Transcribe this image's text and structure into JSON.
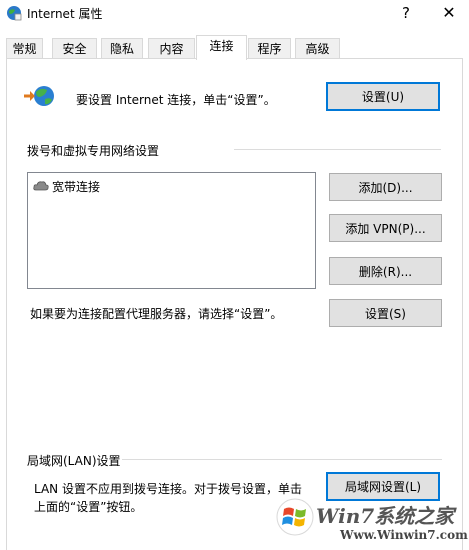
{
  "window": {
    "title": "Internet 属性",
    "help": "?",
    "close": "✕"
  },
  "tabs": [
    {
      "label": "常规"
    },
    {
      "label": "安全"
    },
    {
      "label": "隐私"
    },
    {
      "label": "内容"
    },
    {
      "label": "连接",
      "active": true
    },
    {
      "label": "程序"
    },
    {
      "label": "高级"
    }
  ],
  "setup": {
    "text": "要设置 Internet 连接，单击“设置”。",
    "button": "设置(U)"
  },
  "dialup": {
    "heading": "拨号和虚拟专用网络设置",
    "connections": [
      "宽带连接"
    ],
    "add_button": "添加(D)...",
    "add_vpn_button": "添加 VPN(P)...",
    "remove_button": "删除(R)...",
    "proxy_text": "如果要为连接配置代理服务器，请选择“设置”。",
    "settings_button": "设置(S)"
  },
  "lan": {
    "heading": "局域网(LAN)设置",
    "text_line1": "LAN 设置不应用到拨号连接。对于拨号设置，单击",
    "text_line2": "上面的“设置”按钮。",
    "button": "局域网设置(L)"
  },
  "watermark": {
    "title": "Win7系统之家",
    "url": "Www.Winwin7.com"
  },
  "colors": {
    "accent": "#0078d7",
    "button_bg": "#e1e1e1",
    "button_border": "#adadad"
  }
}
